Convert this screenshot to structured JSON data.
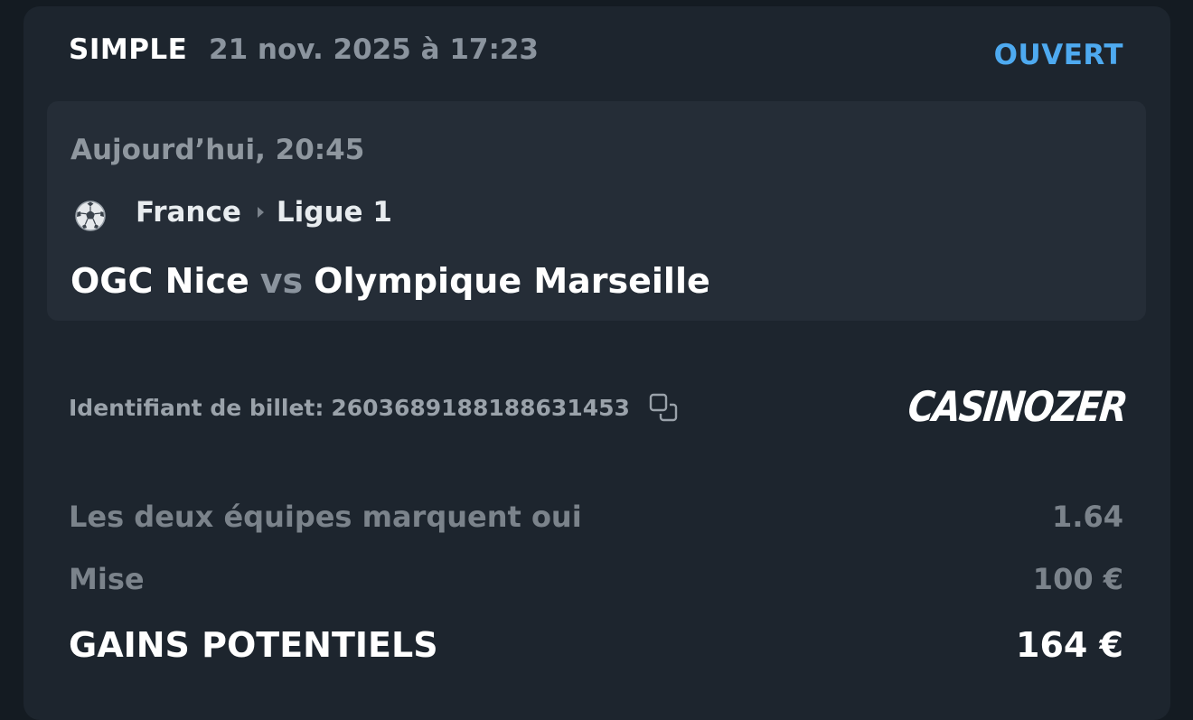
{
  "header": {
    "bet_type": "SIMPLE",
    "placed_date": "21 nov. 2025 à 17:23",
    "status": "OUVERT"
  },
  "event": {
    "start_time": "Aujourd’hui, 20:45",
    "sport_icon": "soccer-ball-icon",
    "country": "France",
    "league": "Ligue 1",
    "home_team": "OGC Nice",
    "vs_label": "vs",
    "away_team": "Olympique Marseille"
  },
  "ticket": {
    "id_label": "Identifiant de billet:",
    "id_value": "2603689188188631453",
    "copy_icon": "copy-icon",
    "brand_logo": "CASINOZER"
  },
  "selection": {
    "label": "Les deux équipes marquent oui",
    "odds": "1.64"
  },
  "stake": {
    "label": "Mise",
    "value": "100 €"
  },
  "potential_gains": {
    "label": "GAINS POTENTIELS",
    "value": "164 €"
  },
  "colors": {
    "background": "#141b22",
    "card": "#1d252e",
    "event_box": "#252d37",
    "status_accent": "#4eaaf0",
    "logo_accent": "#3fd0d8"
  }
}
